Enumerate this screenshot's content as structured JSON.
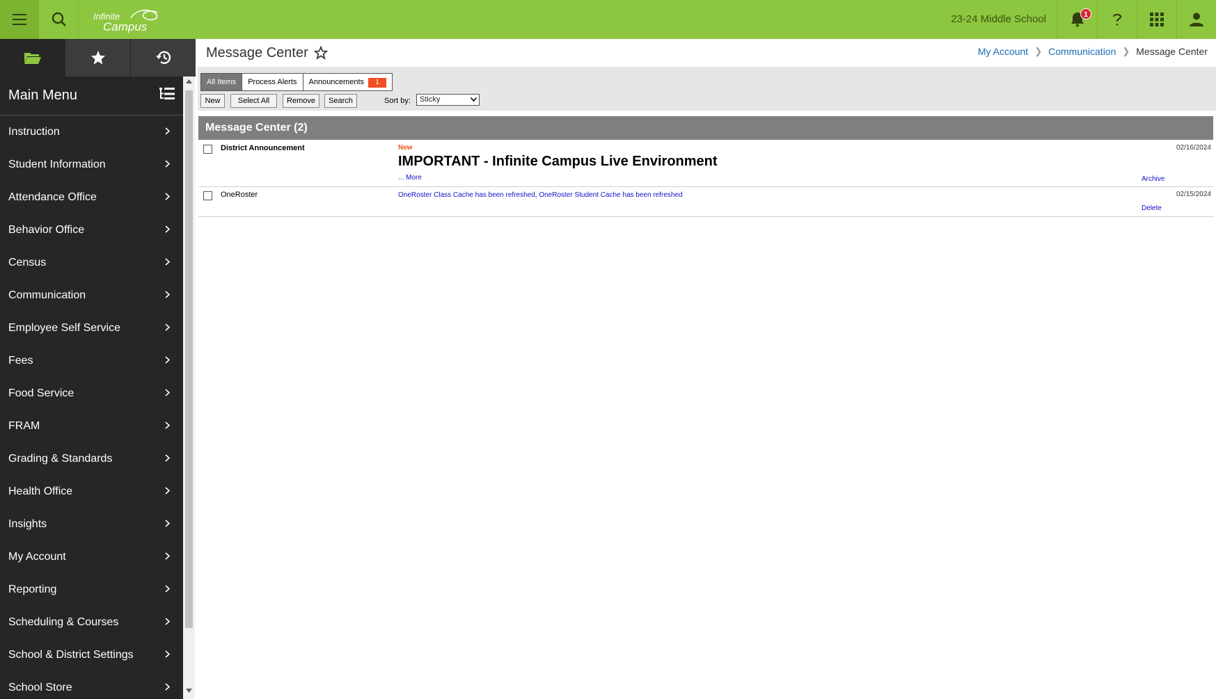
{
  "topbar": {
    "logo_line1": "Infinite",
    "logo_line2": "Campus",
    "school": "23-24 Middle School",
    "notification_count": "1",
    "icons": [
      "menu-icon",
      "search-icon",
      "bell-icon",
      "help-icon",
      "apps-grid-icon",
      "user-icon"
    ],
    "color": "#8dc63f"
  },
  "sidebar": {
    "tabs": [
      "folder-icon",
      "star-icon",
      "history-icon"
    ],
    "title": "Main Menu",
    "items": [
      {
        "label": "Instruction"
      },
      {
        "label": "Student Information"
      },
      {
        "label": "Attendance Office"
      },
      {
        "label": "Behavior Office"
      },
      {
        "label": "Census"
      },
      {
        "label": "Communication"
      },
      {
        "label": "Employee Self Service"
      },
      {
        "label": "Fees"
      },
      {
        "label": "Food Service"
      },
      {
        "label": "FRAM"
      },
      {
        "label": "Grading & Standards"
      },
      {
        "label": "Health Office"
      },
      {
        "label": "Insights"
      },
      {
        "label": "My Account"
      },
      {
        "label": "Reporting"
      },
      {
        "label": "Scheduling & Courses"
      },
      {
        "label": "School & District Settings"
      },
      {
        "label": "School Store"
      }
    ]
  },
  "page": {
    "title": "Message Center",
    "breadcrumb": [
      "My Account",
      "Communication",
      "Message Center"
    ]
  },
  "toolbar": {
    "tabs": [
      "All Items",
      "Process Alerts",
      "Announcements"
    ],
    "announcements_badge": "1",
    "buttons": [
      "New",
      "Select All",
      "Remove",
      "Search"
    ],
    "sort_label": "Sort by:",
    "sort_value": "Sticky"
  },
  "message_center": {
    "header": "Message Center (2)",
    "rows": [
      {
        "from": "District Announcement",
        "status": "New",
        "title": "IMPORTANT - Infinite Campus Live Environment",
        "more": "... More",
        "date": "02/16/2024",
        "action": "Archive"
      },
      {
        "from": "OneRoster",
        "message": "OneRoster Class Cache has been refreshed, OneRoster Student Cache has been refreshed",
        "date": "02/15/2024",
        "action": "Delete"
      }
    ]
  }
}
